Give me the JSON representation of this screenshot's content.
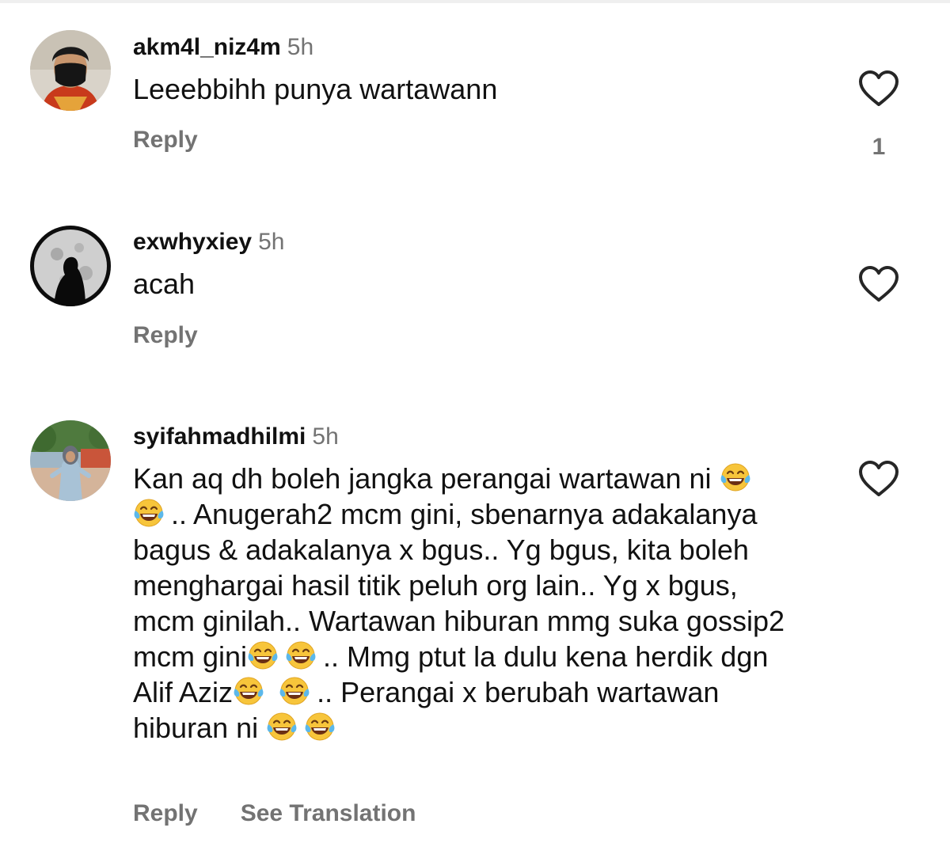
{
  "comments": [
    {
      "username": "akm4l_niz4m",
      "time": "5h",
      "text": "Leeebbihh punya wartawann",
      "reply_label": "Reply",
      "like_count": "1",
      "avatar": "person-in-black-mask",
      "like_icon": "heart-outline-icon"
    },
    {
      "username": "exwhyxiey",
      "time": "5h",
      "text": "acah",
      "reply_label": "Reply",
      "avatar": "moon-silhouette",
      "like_icon": "heart-outline-icon"
    },
    {
      "username": "syifahmadhilmi",
      "time": "5h",
      "text_segments": [
        "Kan aq dh boleh jangka perangai wartawan ni ",
        ".. Anugerah2 mcm gini, sbenarnya adakalanya bagus & adakalanya x bgus.. Yg bgus, kita boleh menghargai hasil titik peluh org lain.. Yg x bgus, mcm ginilah.. Wartawan hiburan mmg suka gossip2 mcm gini",
        ".. Mmg ptut la dulu kena herdik dgn Alif Aziz",
        ".. Perangai x berubah wartawan hiburan ni"
      ],
      "emoji_name": "face-with-tears-of-joy-icon",
      "reply_label": "Reply",
      "translate_label": "See Translation",
      "avatar": "woman-in-hijab-outdoor",
      "like_icon": "heart-outline-icon"
    }
  ],
  "colors": {
    "text": "#111111",
    "muted": "#737373",
    "icon": "#262626"
  }
}
